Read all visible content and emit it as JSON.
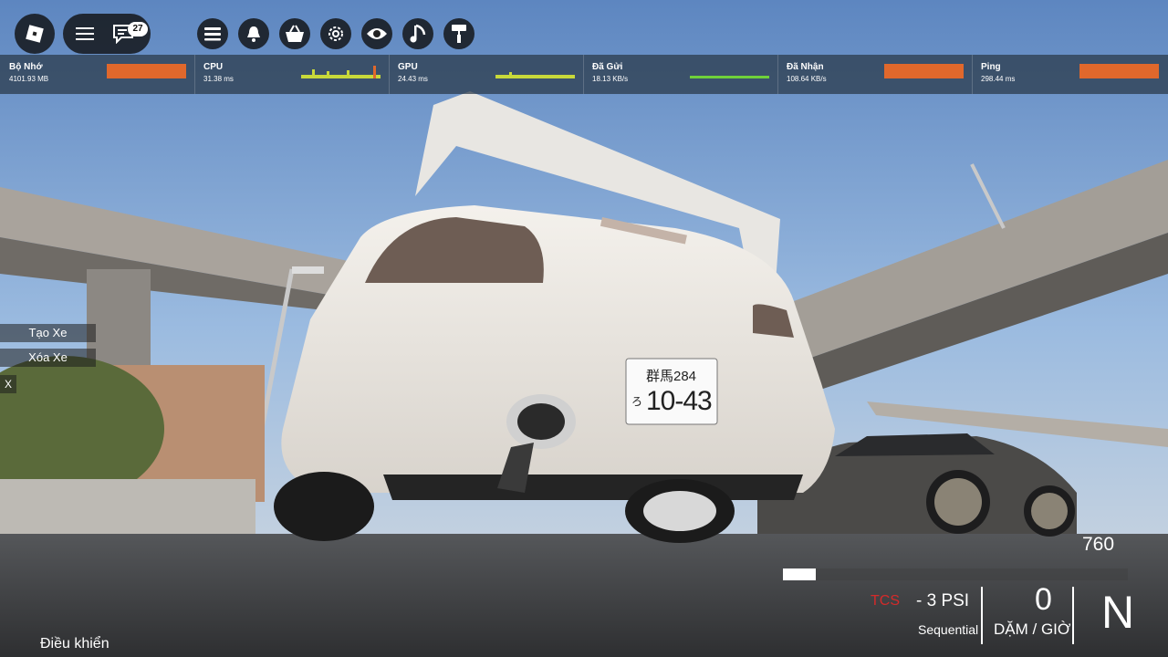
{
  "topbar": {
    "chat_badge": "27"
  },
  "stats": [
    {
      "label": "Bộ Nhớ",
      "value": "4101.93 MB",
      "bar_color": "#e0682c"
    },
    {
      "label": "CPU",
      "value": "31.38 ms",
      "bar_color": "#c8d93a"
    },
    {
      "label": "GPU",
      "value": "24.43 ms",
      "bar_color": "#c8d93a"
    },
    {
      "label": "Đã Gửi",
      "value": "18.13 KB/s",
      "bar_color": "#6fd13a"
    },
    {
      "label": "Đã Nhận",
      "value": "108.64 KB/s",
      "bar_color": "#e0682c"
    },
    {
      "label": "Ping",
      "value": "298.44 ms",
      "bar_color": "#e0682c"
    }
  ],
  "side_menu": {
    "spawn_label": "Tạo Xe",
    "delete_label": "Xóa Xe",
    "close_label": "X"
  },
  "plate": {
    "top": "群馬284",
    "kana": "ろ",
    "number": "10-43"
  },
  "hud": {
    "rpm": "760",
    "tcs": "TCS",
    "boost": "- 3 PSI",
    "transmission": "Sequential",
    "speed": "0",
    "speed_unit": "DẶM / GIỜ",
    "gear": "N",
    "controls_label": "Điều khiển"
  }
}
